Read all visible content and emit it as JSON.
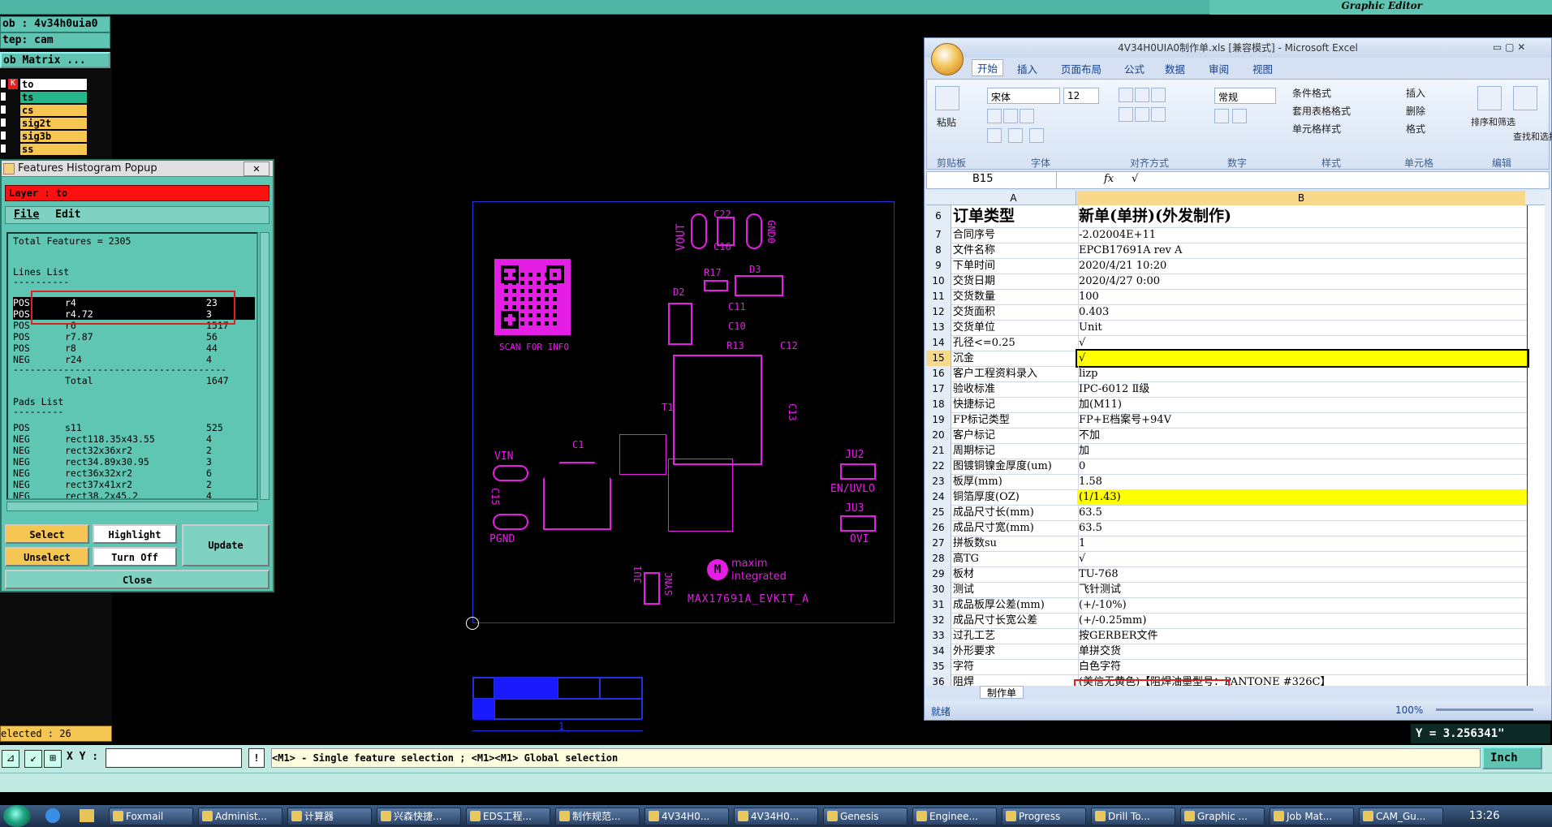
{
  "cam": {
    "job_label": "ob : 4v34h0uia0",
    "step_label": "tep: cam",
    "job_matrix_label": "ob Matrix ...",
    "layers": [
      {
        "name": "to",
        "color": "#ffffff"
      },
      {
        "name": "ts",
        "color": "#27b58c"
      },
      {
        "name": "cs",
        "color": "#f6c653"
      },
      {
        "name": "sig2t",
        "color": "#f6c653"
      },
      {
        "name": "sig3b",
        "color": "#f6c653"
      },
      {
        "name": "ss",
        "color": "#f6c653"
      }
    ],
    "selected_label": "elected : 26",
    "xy_label": "X Y :",
    "xy_value": "",
    "hint": "<M1> - Single feature selection ; <M1><M1> Global selection",
    "unit": "Inch",
    "coord_readout": "Y = 3.256341\"",
    "graphic_editor_title": "Graphic Editor"
  },
  "pcb": {
    "labels": {
      "vout": "VOUT",
      "gnd0": "GND0",
      "c22": "C22",
      "c16": "C16",
      "r17": "R17",
      "d3": "D3",
      "d2": "D2",
      "c11": "C11",
      "c10": "C10",
      "r13": "R13",
      "c12": "C12",
      "scan": "SCAN FOR INFO",
      "t1": "T1",
      "c13": "C13",
      "vin": "VIN",
      "c1": "C1",
      "c15": "C15",
      "pgnd": "PGND",
      "ju2": "JU2",
      "enuvlo": "EN/UVLO",
      "ju3": "JU3",
      "ovi": "OVI",
      "ju1": "JU1",
      "sync": "SYNC",
      "brand1": "maxim",
      "brand2": "integrated",
      "kit": "MAX17691A_EVKIT_A",
      "scale": "1"
    }
  },
  "histogram": {
    "title": "Features Histogram Popup",
    "close": "✕",
    "layer": "Layer :  to",
    "menu": {
      "file": "File",
      "edit": "Edit"
    },
    "total": "Total Features = 2305",
    "lines_header": "Lines List",
    "lines": [
      {
        "pol": "POS",
        "sym": "r4",
        "count": "23"
      },
      {
        "pol": "POS",
        "sym": "r4.72",
        "count": "3"
      },
      {
        "pol": "POS",
        "sym": "r6",
        "count": "1517"
      },
      {
        "pol": "POS",
        "sym": "r7.87",
        "count": "56"
      },
      {
        "pol": "POS",
        "sym": "r8",
        "count": "44"
      },
      {
        "pol": "NEG",
        "sym": "r24",
        "count": "4"
      }
    ],
    "total_label": "Total",
    "total_value": "1647",
    "pads_header": "Pads List",
    "pads": [
      {
        "pol": "POS",
        "sym": "s11",
        "count": "525"
      },
      {
        "pol": "NEG",
        "sym": "rect118.35x43.55",
        "count": "4"
      },
      {
        "pol": "NEG",
        "sym": "rect32x36xr2",
        "count": "2"
      },
      {
        "pol": "NEG",
        "sym": "rect34.89x30.95",
        "count": "3"
      },
      {
        "pol": "NEG",
        "sym": "rect36x32xr2",
        "count": "6"
      },
      {
        "pol": "NEG",
        "sym": "rect37x41xr2",
        "count": "2"
      },
      {
        "pol": "NEG",
        "sym": "rect38.2x45.2",
        "count": "4"
      }
    ],
    "buttons": {
      "select": "Select",
      "highlight": "Highlight",
      "unselect": "Unselect",
      "turn_off": "Turn Off",
      "update": "Update",
      "close": "Close"
    }
  },
  "excel": {
    "title": "4V34H0UIA0制作单.xls  [兼容模式] - Microsoft Excel",
    "tabs": [
      "开始",
      "插入",
      "页面布局",
      "公式",
      "数据",
      "审阅",
      "视图"
    ],
    "ribbon": {
      "paste": "粘贴",
      "font_name": "宋体",
      "font_size": "12",
      "number_format": "常规",
      "cond_format": "条件格式",
      "table_format": "套用表格格式",
      "cell_style": "单元格样式",
      "insert": "插入",
      "delete": "删除",
      "format": "格式",
      "sort": "排序和筛选",
      "find": "查找和选择",
      "groups": [
        "剪贴板",
        "字体",
        "对齐方式",
        "数字",
        "样式",
        "单元格",
        "编辑"
      ]
    },
    "namebox": "B15",
    "fx": "fx",
    "formula_value": "√",
    "col_a": "A",
    "col_b": "B",
    "rows": [
      {
        "n": "6",
        "a": "订单类型",
        "b": "新单(单拼)(外发制作)"
      },
      {
        "n": "7",
        "a": "合同序号",
        "b": "-2.02004E+11"
      },
      {
        "n": "8",
        "a": "文件名称",
        "b": "EPCB17691A rev A"
      },
      {
        "n": "9",
        "a": "下单时间",
        "b": "2020/4/21 10:20"
      },
      {
        "n": "10",
        "a": "交货日期",
        "b": "2020/4/27 0:00"
      },
      {
        "n": "11",
        "a": "交货数量",
        "b": "100"
      },
      {
        "n": "12",
        "a": "交货面积",
        "b": "0.403"
      },
      {
        "n": "13",
        "a": "交货单位",
        "b": "Unit"
      },
      {
        "n": "14",
        "a": "孔径<=0.25",
        "b": "√"
      },
      {
        "n": "15",
        "a": "沉金",
        "b": "√"
      },
      {
        "n": "16",
        "a": "客户工程资料录入",
        "b": "lizp"
      },
      {
        "n": "17",
        "a": "验收标准",
        "b": "IPC-6012 Ⅱ级"
      },
      {
        "n": "18",
        "a": "快捷标记",
        "b": "加(M11)"
      },
      {
        "n": "19",
        "a": "FP标记类型",
        "b": "FP+E档案号+94V"
      },
      {
        "n": "20",
        "a": "客户标记",
        "b": "不加"
      },
      {
        "n": "21",
        "a": "周期标记",
        "b": "加"
      },
      {
        "n": "22",
        "a": "图镀铜镍金厚度(um)",
        "b": "0"
      },
      {
        "n": "23",
        "a": "板厚(mm)",
        "b": "1.58"
      },
      {
        "n": "24",
        "a": "铜箔厚度(OZ)",
        "b": "(1/1.43)"
      },
      {
        "n": "25",
        "a": "成品尺寸长(mm)",
        "b": "63.5"
      },
      {
        "n": "26",
        "a": "成品尺寸宽(mm)",
        "b": "63.5"
      },
      {
        "n": "27",
        "a": "拼板数su",
        "b": "1"
      },
      {
        "n": "28",
        "a": "高TG",
        "b": "√"
      },
      {
        "n": "29",
        "a": "板材",
        "b": "TU-768"
      },
      {
        "n": "30",
        "a": "测试",
        "b": "飞针测试"
      },
      {
        "n": "31",
        "a": "成品板厚公差(mm)",
        "b": "(+/-10%)"
      },
      {
        "n": "32",
        "a": "成品尺寸长宽公差",
        "b": "(+/-0.25mm)"
      },
      {
        "n": "33",
        "a": "过孔工艺",
        "b": "按GERBER文件"
      },
      {
        "n": "34",
        "a": "外形要求",
        "b": "单拼交货"
      },
      {
        "n": "35",
        "a": "字符",
        "b": "白色字符"
      },
      {
        "n": "36",
        "a": "阻焊",
        "b": "(美信无黄色)【阻焊油墨型号：PANTONE #326C】"
      }
    ],
    "sheet_tab": "制作单",
    "status_ready": "就绪",
    "zoom": "100%"
  },
  "taskbar": {
    "items": [
      "Foxmail",
      "Administ...",
      "计算器",
      "兴森快捷...",
      "EDS工程...",
      "制作规范...",
      "4V34H0...",
      "4V34H0...",
      "Genesis",
      "Enginee...",
      "Progress",
      "Drill To...",
      "Graphic ...",
      "Job Mat...",
      "CAM_Gu..."
    ],
    "clock": "13:26"
  }
}
